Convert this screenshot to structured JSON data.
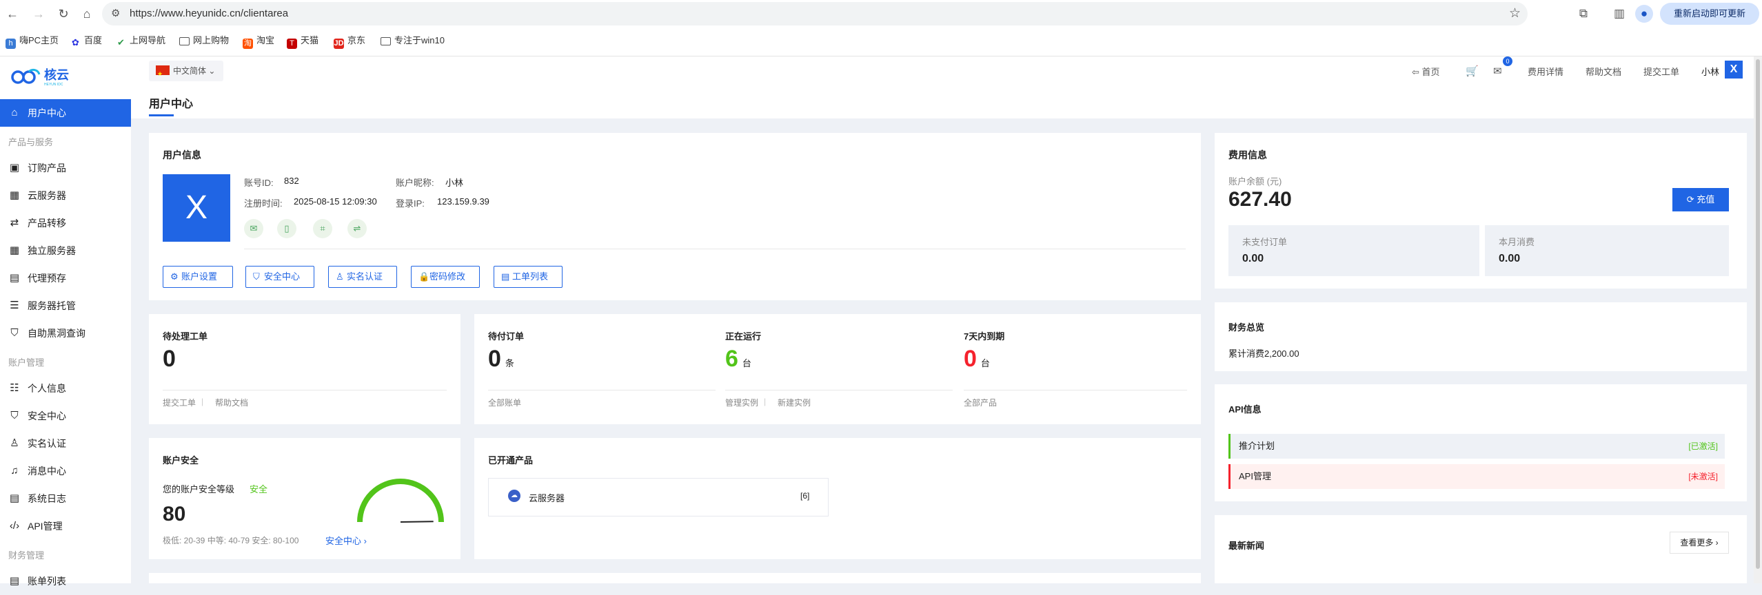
{
  "browser": {
    "url": "https://www.heyunidc.cn/clientarea",
    "update_button": "重新启动即可更新",
    "bookmarks": [
      {
        "label": "嗨PC主页",
        "icon": "hipc-icon",
        "color": "#3a7bd5"
      },
      {
        "label": "百度",
        "icon": "baidu-paw-icon",
        "color": "#2932e1"
      },
      {
        "label": "上网导航",
        "icon": "nav-icon",
        "color": "#2e9b4b"
      },
      {
        "label": "网上购物",
        "icon": "folder-icon",
        "color": ""
      },
      {
        "label": "淘宝",
        "icon": "taobao-icon",
        "color": "#ff5000"
      },
      {
        "label": "天猫",
        "icon": "tmall-icon",
        "color": "#c40000"
      },
      {
        "label": "京东",
        "icon": "jd-icon",
        "color": "#e1251b"
      },
      {
        "label": "专注于win10",
        "icon": "folder-icon",
        "color": ""
      }
    ]
  },
  "brand": {
    "name": "核云",
    "tagline": "HEYUN IDC",
    "accent": "#2065e4"
  },
  "sidebar": {
    "items": [
      {
        "label": "用户中心",
        "icon": "home-icon",
        "active": true
      },
      {
        "section": "产品与服务"
      },
      {
        "label": "订购产品",
        "icon": "bag-icon"
      },
      {
        "label": "云服务器",
        "icon": "grid-icon"
      },
      {
        "label": "产品转移",
        "icon": "transfer-icon"
      },
      {
        "label": "独立服务器",
        "icon": "grid-icon"
      },
      {
        "label": "代理预存",
        "icon": "ledger-icon"
      },
      {
        "label": "服务器托管",
        "icon": "list-icon"
      },
      {
        "label": "自助黑洞查询",
        "icon": "shield-icon"
      },
      {
        "section": "账户管理"
      },
      {
        "label": "个人信息",
        "icon": "person-card-icon"
      },
      {
        "label": "安全中心",
        "icon": "shield-icon"
      },
      {
        "label": "实名认证",
        "icon": "user-icon"
      },
      {
        "label": "消息中心",
        "icon": "bell-icon"
      },
      {
        "label": "系统日志",
        "icon": "log-icon"
      },
      {
        "label": "API管理",
        "icon": "code-icon"
      },
      {
        "section": "财务管理"
      },
      {
        "label": "账单列表",
        "icon": "bill-icon"
      }
    ]
  },
  "topbar": {
    "language": "中文简体",
    "home": "首页",
    "mail_badge": "0",
    "fees": "费用详情",
    "docs": "帮助文档",
    "ticket": "提交工单",
    "username": "小林",
    "avatar_letter": "X"
  },
  "page_title": "用户中心",
  "user_info": {
    "title": "用户信息",
    "avatar_letter": "X",
    "account_id_label": "账号ID:",
    "account_id": "832",
    "nickname_label": "账户昵称:",
    "nickname": "小林",
    "register_label": "注册时间:",
    "register_time": "2025-08-15 12:09:30",
    "login_ip_label": "登录IP:",
    "login_ip": "123.159.9.39",
    "buttons": [
      "账户设置",
      "安全中心",
      "实名认证",
      "密码修改",
      "工单列表"
    ]
  },
  "billing": {
    "title": "费用信息",
    "balance_label": "账户余额 (元)",
    "balance": "627.40",
    "recharge": "充值",
    "unpaid_label": "未支付订单",
    "unpaid": "0.00",
    "month_label": "本月消费",
    "month": "0.00"
  },
  "pending_tickets": {
    "title": "待处理工单",
    "count": "0",
    "link1": "提交工单",
    "link2": "帮助文档"
  },
  "stats": {
    "pending_orders": {
      "title": "待付订单",
      "count": "0",
      "unit": "条",
      "link": "全部账单"
    },
    "running": {
      "title": "正在运行",
      "count": "6",
      "unit": "台",
      "link1": "管理实例",
      "link2": "新建实例",
      "color": "#52c41a"
    },
    "expiring": {
      "title": "7天内到期",
      "count": "0",
      "unit": "台",
      "link": "全部产品",
      "color": "#f5222d"
    }
  },
  "finance": {
    "title": "财务总览",
    "total": "累计消费2,200.00"
  },
  "security": {
    "title": "账户安全",
    "level_label": "您的账户安全等级",
    "level": "安全",
    "score": 80,
    "legend": "极低: 20-39 中等: 40-79 安全: 80-100",
    "link": "安全中心"
  },
  "products": {
    "title": "已开通产品",
    "items": [
      {
        "name": "云服务器",
        "count": "[6]"
      }
    ]
  },
  "api": {
    "title": "API信息",
    "rows": [
      {
        "name": "推介计划",
        "status": "[已激活]",
        "color": "#52c41a"
      },
      {
        "name": "API管理",
        "status": "[未激活]",
        "color": "#f5222d"
      }
    ]
  },
  "news": {
    "title": "最新新闻",
    "more": "查看更多"
  }
}
